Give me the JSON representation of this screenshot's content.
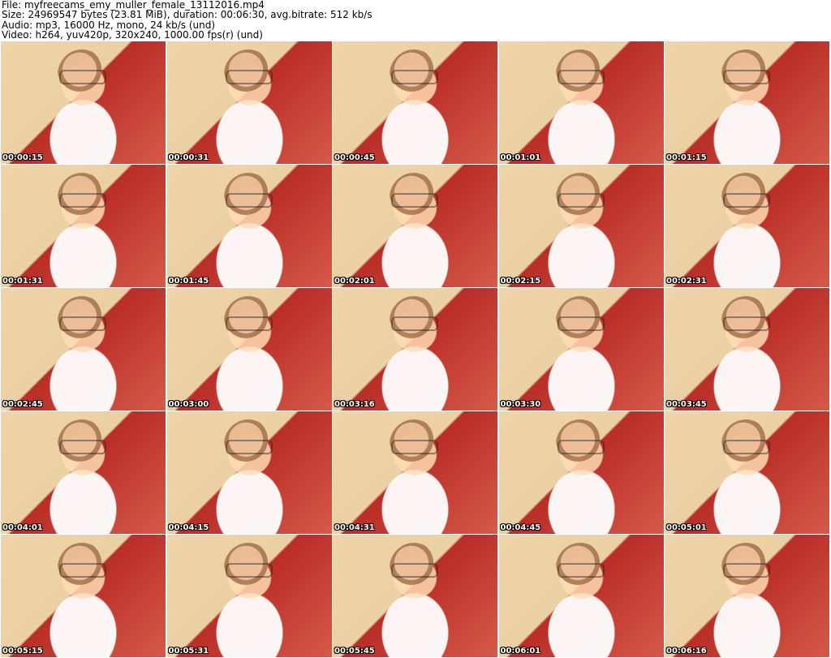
{
  "header": {
    "file": "File: myfreecams_emy_muller_female_13112016.mp4",
    "size": "Size: 24969547 bytes (23.81 MiB), duration: 00:06:30, avg.bitrate: 512 kb/s",
    "audio": "Audio: mp3, 16000 Hz, mono, 24 kb/s (und)",
    "video": "Video: h264, yuv420p, 320x240, 1000.00 fps(r) (und)"
  },
  "thumbnails": [
    {
      "timestamp": "00:00:15"
    },
    {
      "timestamp": "00:00:31"
    },
    {
      "timestamp": "00:00:45"
    },
    {
      "timestamp": "00:01:01"
    },
    {
      "timestamp": "00:01:15"
    },
    {
      "timestamp": "00:01:31"
    },
    {
      "timestamp": "00:01:45"
    },
    {
      "timestamp": "00:02:01"
    },
    {
      "timestamp": "00:02:15"
    },
    {
      "timestamp": "00:02:31"
    },
    {
      "timestamp": "00:02:45"
    },
    {
      "timestamp": "00:03:00"
    },
    {
      "timestamp": "00:03:16"
    },
    {
      "timestamp": "00:03:30"
    },
    {
      "timestamp": "00:03:45"
    },
    {
      "timestamp": "00:04:01"
    },
    {
      "timestamp": "00:04:15"
    },
    {
      "timestamp": "00:04:31"
    },
    {
      "timestamp": "00:04:45"
    },
    {
      "timestamp": "00:05:01"
    },
    {
      "timestamp": "00:05:15"
    },
    {
      "timestamp": "00:05:31"
    },
    {
      "timestamp": "00:05:45"
    },
    {
      "timestamp": "00:06:01"
    },
    {
      "timestamp": "00:06:16"
    }
  ]
}
